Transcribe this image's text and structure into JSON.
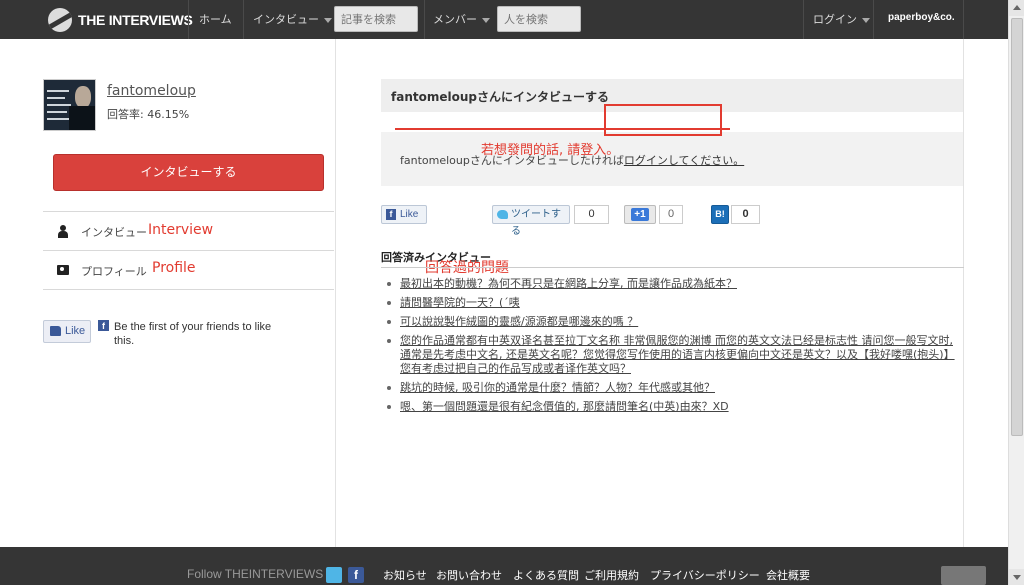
{
  "header": {
    "logo_text": "THE INTERVIEWS",
    "nav": {
      "home": "ホーム",
      "interview": "インタビュー",
      "search_articles_placeholder": "記事を検索",
      "member": "メンバー",
      "search_people_placeholder": "人を検索",
      "login": "ログイン",
      "paperboy": "paperboy&co."
    }
  },
  "profile": {
    "username": "fantomeloup",
    "answer_rate": "回答率: 46.15%",
    "interview_button": "インタビューする",
    "menu": [
      {
        "label": "インタビュー",
        "annotation": "Interview"
      },
      {
        "label": "プロフィール",
        "annotation": "Profile"
      }
    ],
    "facebook": {
      "like_label": "Like",
      "fb_letter": "f",
      "friends_text": "Be the first of your friends to like this."
    }
  },
  "main": {
    "title": "fantomeloupさんにインタビューする",
    "login_prompt": "fantomeloupさんにインタビューしたければ",
    "login_link": "ログインしてください。",
    "login_annotation": "若想發問的話, 請登入。",
    "share": {
      "fb_like": "Like",
      "tweet": "ツイートする",
      "tweet_count": "0",
      "plus_one": "+1",
      "plus_count": "0",
      "hatena": "B!",
      "hatena_count": "0"
    },
    "answered_title": "回答済みインタビュー",
    "answered_annotation": "回答過的問題",
    "questions": [
      "最初出本的動機？為何不再只是在網路上分享, 而是讓作品成為紙本？",
      "請問醫學院的一天？(ˊ咦",
      "可以說說製作絨圖的靈感/源源都是哪邊來的嗎 ？",
      "您的作品通常都有中英双译名甚至拉丁文名称 非常佩服您的渊博 而您的英文文法已经是标志性 请问您一般写文时, 通常是先考虑中文名, 还是英文名呢？您觉得您写作使用的语言内核更偏向中文还是英文？以及【我好喽嘿(抱头)】您有考虑过把自己的作品写成或者译作英文吗？",
      "跳坑的時候, 吸引你的通常是什麼？情節？人物？年代感或其他？",
      "嗯、第一個問題還是很有紀念價值的, 那麼請問筆名(中英)由來？XD"
    ]
  },
  "footer": {
    "follow": "Follow THEINTERVIEWS",
    "fb_letter": "f",
    "links": [
      "お知らせ",
      "お問い合わせ",
      "よくある質問",
      "ご利用規約",
      "プライバシーポリシー",
      "会社概要"
    ]
  },
  "colors": {
    "nav_bg": "#353535",
    "accent_red": "#d9413c",
    "annotation_red": "#e23b30",
    "facebook_blue": "#3b5998"
  }
}
